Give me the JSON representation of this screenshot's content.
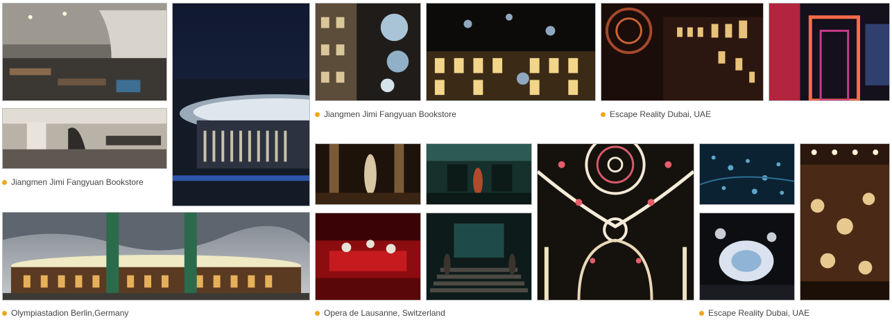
{
  "captions": {
    "bookstore_left": "Jiangmen Jimi Fangyuan Bookstore",
    "bookstore_top": "Jiangmen Jimi Fangyuan Bookstore",
    "escape_top": "Escape Reality Dubai, UAE",
    "olympia": "Olympiastadion Berlin,Germany",
    "opera": "Opera de Lausanne, Switzerland",
    "escape_bottom": "Escape Reality Dubai, UAE"
  },
  "colors": {
    "bullet": "#f2a51e",
    "caption_text": "#444444"
  }
}
